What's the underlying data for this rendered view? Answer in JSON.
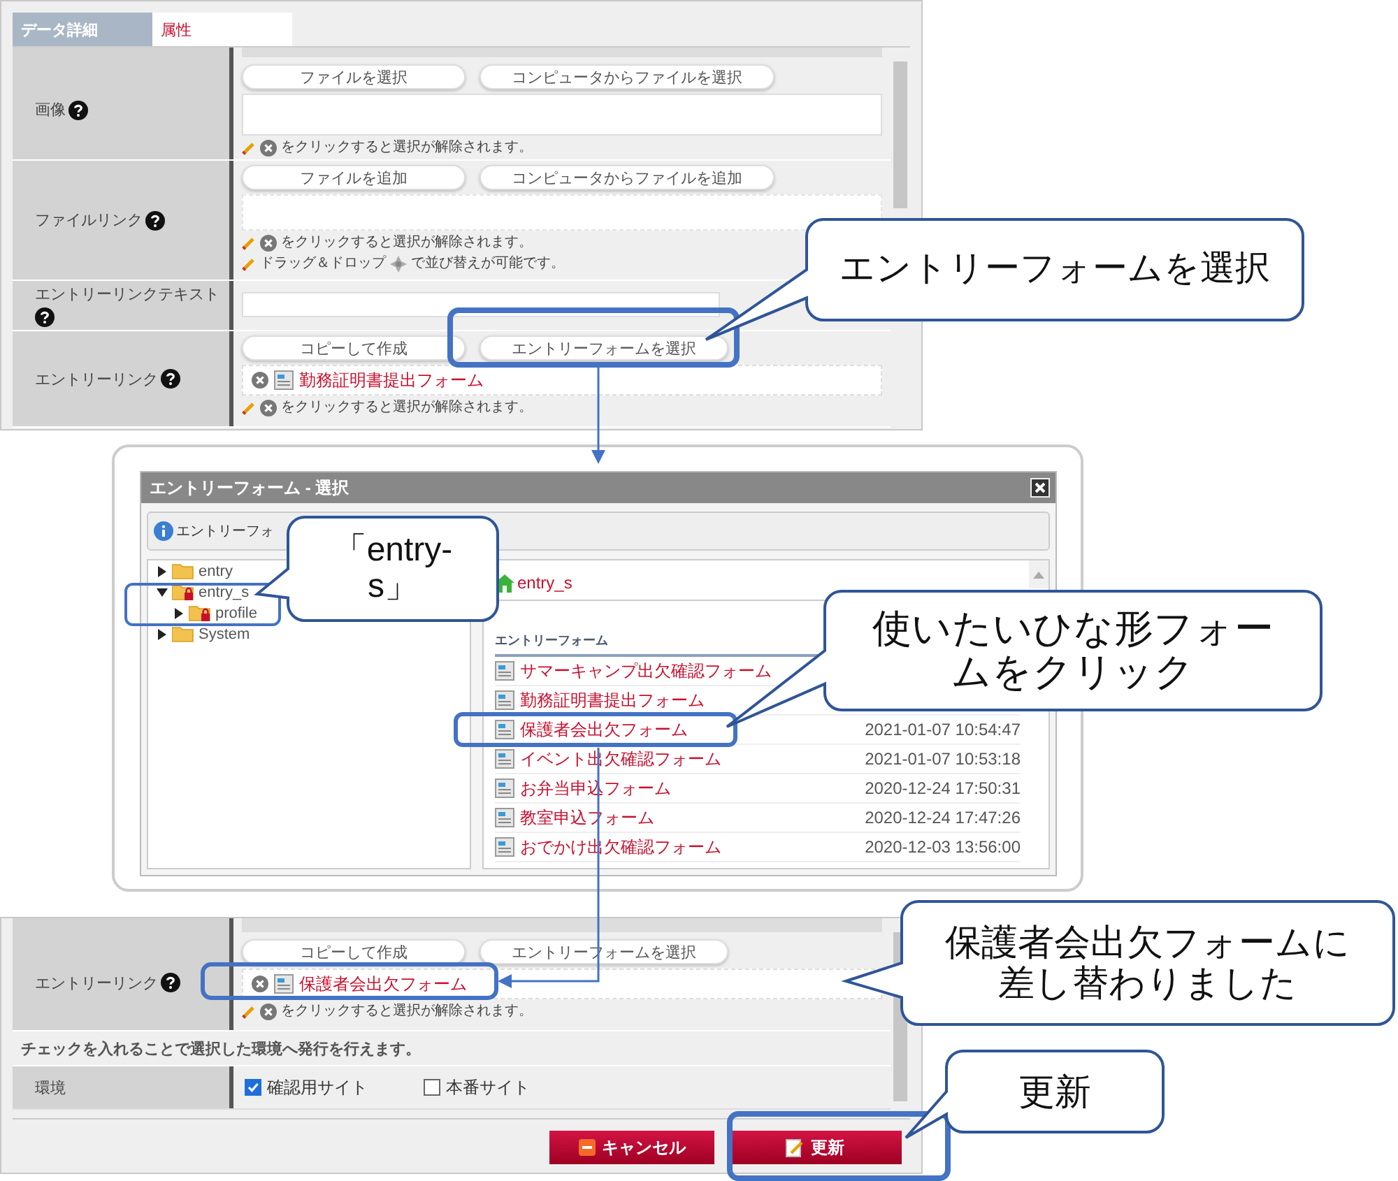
{
  "top_panel": {
    "tabs": [
      {
        "label": "データ詳細",
        "selected": false
      },
      {
        "label": "属性",
        "selected": true
      }
    ],
    "fields": [
      {
        "label": "画像",
        "help": true,
        "kind": "file",
        "buttons": [
          "ファイルを選択",
          "コンピュータからファイルを選択"
        ],
        "notes": [
          {
            "kind": "remove",
            "text": "をクリックすると選択が解除されます。"
          }
        ]
      },
      {
        "label": "ファイルリンク",
        "help": true,
        "kind": "dropzone",
        "buttons": [
          "ファイルを追加",
          "コンピュータからファイルを追加"
        ],
        "notes": [
          {
            "kind": "remove",
            "text": "をクリックすると選択が解除されます。"
          },
          {
            "kind": "drag",
            "before": "ドラッグ＆ドロップ",
            "after": "で並び替えが可能です。"
          }
        ]
      },
      {
        "label": "エントリーリンクテキスト",
        "help": true,
        "kind": "text"
      },
      {
        "label": "エントリーリンク",
        "help": true,
        "kind": "link",
        "buttons": [
          "コピーして作成",
          "エントリーフォームを選択"
        ],
        "value": "勤務証明書提出フォーム",
        "notes": [
          {
            "kind": "remove",
            "text": "をクリックすると選択が解除されます。"
          }
        ]
      }
    ]
  },
  "dialog": {
    "title": "エントリーフォーム - 選択",
    "info": "エントリーフォ",
    "tree": [
      {
        "label": "entry",
        "expanded": false,
        "locked": false
      },
      {
        "label": "entry_s",
        "expanded": true,
        "locked": true,
        "children": [
          {
            "label": "profile",
            "expanded": false,
            "locked": true
          }
        ]
      },
      {
        "label": "System",
        "expanded": false,
        "locked": false
      }
    ],
    "breadcrumb": "entry_s",
    "section": "エントリーフォーム",
    "forms": [
      {
        "name": "サマーキャンプ出欠確認フォーム"
      },
      {
        "name": "勤務証明書提出フォーム"
      },
      {
        "name": "保護者会出欠フォーム",
        "date": "2021-01-07 10:54:47"
      },
      {
        "name": "イベント出欠確認フォーム",
        "date": "2021-01-07 10:53:18"
      },
      {
        "name": "お弁当申込フォーム",
        "date": "2020-12-24 17:50:31"
      },
      {
        "name": "教室申込フォーム",
        "date": "2020-12-24 17:47:26"
      },
      {
        "name": "おでかけ出欠確認フォーム",
        "date": "2020-12-03 13:56:00"
      }
    ]
  },
  "bottom_panel": {
    "fields": [
      {
        "label": "エントリーリンク",
        "help": true,
        "kind": "link",
        "buttons": [
          "コピーして作成",
          "エントリーフォームを選択"
        ],
        "value": "保護者会出欠フォーム",
        "notes": [
          {
            "kind": "remove",
            "text": "をクリックすると選択が解除されます。"
          }
        ]
      }
    ],
    "notice": "チェックを入れることで選択した環境へ発行を行えます。",
    "environment": {
      "label": "環境",
      "options": [
        {
          "label": "確認用サイト",
          "checked": true
        },
        {
          "label": "本番サイト",
          "checked": false
        }
      ]
    },
    "buttons": [
      {
        "label": "キャンセル",
        "kind": "cancel"
      },
      {
        "label": "更新",
        "kind": "update"
      }
    ]
  },
  "callouts": [
    {
      "text": "エントリーフォームを選択"
    },
    {
      "text": "「entry-s」"
    },
    {
      "text": "使いたいひな形フォームをクリック"
    },
    {
      "text": "保護者会出欠フォームに差し替わりました"
    },
    {
      "text": "更新"
    }
  ]
}
